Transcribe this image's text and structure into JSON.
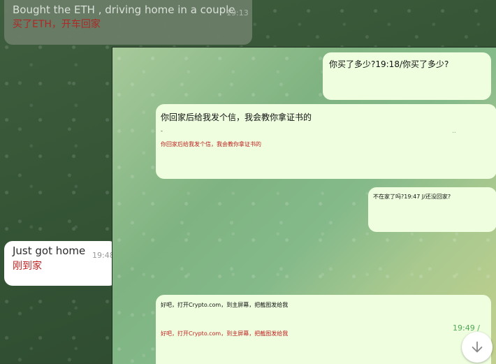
{
  "messages_bg": [
    {
      "en": "Bought the ETH , driving home in a couple",
      "cn": "买了ETH，开车回家",
      "time": "19:13"
    },
    {
      "en": "Just got home",
      "cn": "刚到家",
      "time": "19:48"
    }
  ],
  "messages_chat": [
    {
      "text": "你买了多少?19:18/你买了多少?"
    },
    {
      "text": "你回家后给我发个信，我会教你拿证书的",
      "partial": "-",
      "partial_time": "..",
      "cn": "你回家后给我发个信，我会教你拿证书的"
    },
    {
      "text": "不在家了吗?19:47 J/还没回家?"
    },
    {
      "text": "好吧，打开Crypto.com，到主屏幕，把截图发给我",
      "cn": "好吧，打开Crypto.com，到主屏幕，把截图发给我",
      "time": "19:49 /"
    }
  ],
  "scroll_icon": "arrow-down-icon"
}
